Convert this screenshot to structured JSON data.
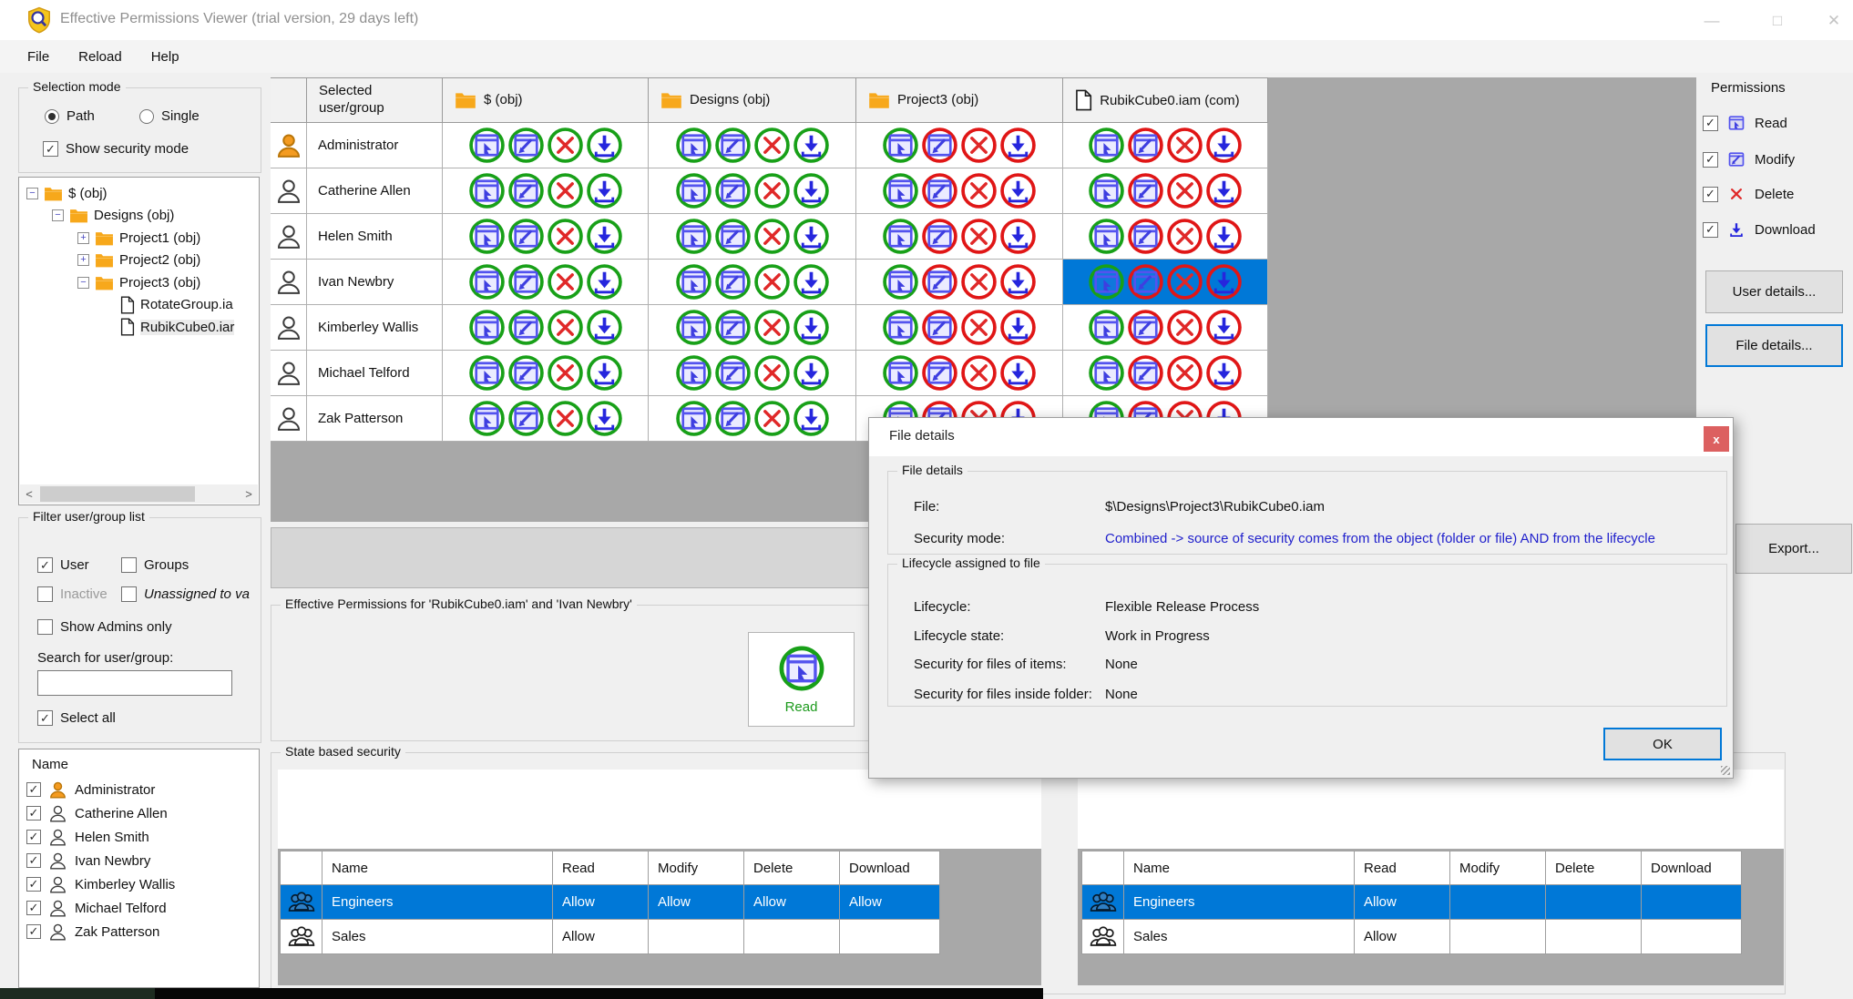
{
  "window": {
    "title": "Effective Permissions Viewer (trial version, 29 days left)",
    "controls": [
      "minimize",
      "maximize",
      "close"
    ]
  },
  "menu": {
    "items": [
      "File",
      "Reload",
      "Help"
    ]
  },
  "selection_mode": {
    "title": "Selection mode",
    "radios": [
      {
        "label": "Path",
        "checked": true
      },
      {
        "label": "Single",
        "checked": false
      }
    ],
    "show_security": {
      "label": "Show security mode",
      "checked": true
    }
  },
  "tree": {
    "items": [
      {
        "label": "$ (obj)",
        "icon": "folder",
        "expander": "minus",
        "indent": 0,
        "selected": false
      },
      {
        "label": "Designs (obj)",
        "icon": "folder",
        "expander": "minus",
        "indent": 1,
        "selected": false
      },
      {
        "label": "Project1 (obj)",
        "icon": "folder",
        "expander": "plus",
        "indent": 2,
        "selected": false
      },
      {
        "label": "Project2 (obj)",
        "icon": "folder",
        "expander": "plus",
        "indent": 2,
        "selected": false
      },
      {
        "label": "Project3 (obj)",
        "icon": "folder",
        "expander": "minus",
        "indent": 2,
        "selected": false
      },
      {
        "label": "RotateGroup.ia",
        "icon": "file",
        "expander": "none",
        "indent": 3,
        "selected": false
      },
      {
        "label": "RubikCube0.iar",
        "icon": "file",
        "expander": "none",
        "indent": 3,
        "selected": true
      }
    ]
  },
  "filter": {
    "title": "Filter user/group list",
    "user": {
      "label": "User",
      "checked": true
    },
    "groups": {
      "label": "Groups",
      "checked": false
    },
    "inactive": {
      "label": "Inactive",
      "checked": false
    },
    "unassigned": {
      "label": "Unassigned to va",
      "checked": false
    },
    "admins_only": {
      "label": "Show Admins only",
      "checked": false
    },
    "search_label": "Search for user/group:",
    "search_value": "",
    "select_all": {
      "label": "Select all",
      "checked": true
    }
  },
  "user_list": {
    "header": "Name",
    "users": [
      {
        "name": "Administrator",
        "checked": true,
        "admin": true
      },
      {
        "name": "Catherine Allen",
        "checked": true,
        "admin": false
      },
      {
        "name": "Helen Smith",
        "checked": true,
        "admin": false
      },
      {
        "name": "Ivan Newbry",
        "checked": true,
        "admin": false
      },
      {
        "name": "Kimberley Wallis",
        "checked": true,
        "admin": false
      },
      {
        "name": "Michael Telford",
        "checked": true,
        "admin": false
      },
      {
        "name": "Zak Patterson",
        "checked": true,
        "admin": false
      }
    ]
  },
  "grid": {
    "columns": [
      {
        "label": "Selected user/group",
        "icon": "none"
      },
      {
        "label": "$ (obj)",
        "icon": "folder"
      },
      {
        "label": "Designs (obj)",
        "icon": "folder"
      },
      {
        "label": "Project3 (obj)",
        "icon": "folder"
      },
      {
        "label": "RubikCube0.iam (com)",
        "icon": "file"
      }
    ],
    "permissions": [
      "read",
      "modify",
      "delete",
      "download"
    ],
    "rows": [
      {
        "name": "Administrator",
        "admin": true,
        "selected_col": -1,
        "cells": [
          [
            "allow",
            "allow",
            "allow",
            "allow"
          ],
          [
            "allow",
            "allow",
            "allow",
            "allow"
          ],
          [
            "allow",
            "deny",
            "deny",
            "deny"
          ],
          [
            "allow",
            "deny",
            "deny",
            "deny"
          ]
        ]
      },
      {
        "name": "Catherine Allen",
        "admin": false,
        "selected_col": -1,
        "cells": [
          [
            "allow",
            "allow",
            "allow",
            "allow"
          ],
          [
            "allow",
            "allow",
            "allow",
            "allow"
          ],
          [
            "allow",
            "deny",
            "deny",
            "deny"
          ],
          [
            "allow",
            "deny",
            "deny",
            "deny"
          ]
        ]
      },
      {
        "name": "Helen Smith",
        "admin": false,
        "selected_col": -1,
        "cells": [
          [
            "allow",
            "allow",
            "allow",
            "allow"
          ],
          [
            "allow",
            "allow",
            "allow",
            "allow"
          ],
          [
            "allow",
            "deny",
            "deny",
            "deny"
          ],
          [
            "allow",
            "deny",
            "deny",
            "deny"
          ]
        ]
      },
      {
        "name": "Ivan Newbry",
        "admin": false,
        "selected_col": 3,
        "cells": [
          [
            "allow",
            "allow",
            "allow",
            "allow"
          ],
          [
            "allow",
            "allow",
            "allow",
            "allow"
          ],
          [
            "allow",
            "deny",
            "deny",
            "deny"
          ],
          [
            "allow",
            "deny",
            "deny",
            "deny"
          ]
        ]
      },
      {
        "name": "Kimberley Wallis",
        "admin": false,
        "selected_col": -1,
        "cells": [
          [
            "allow",
            "allow",
            "allow",
            "allow"
          ],
          [
            "allow",
            "allow",
            "allow",
            "allow"
          ],
          [
            "allow",
            "deny",
            "deny",
            "deny"
          ],
          [
            "allow",
            "deny",
            "deny",
            "deny"
          ]
        ]
      },
      {
        "name": "Michael Telford",
        "admin": false,
        "selected_col": -1,
        "cells": [
          [
            "allow",
            "allow",
            "allow",
            "allow"
          ],
          [
            "allow",
            "allow",
            "allow",
            "allow"
          ],
          [
            "allow",
            "deny",
            "deny",
            "deny"
          ],
          [
            "allow",
            "deny",
            "deny",
            "deny"
          ]
        ]
      },
      {
        "name": "Zak Patterson",
        "admin": false,
        "selected_col": -1,
        "cells": [
          [
            "allow",
            "allow",
            "allow",
            "allow"
          ],
          [
            "allow",
            "allow",
            "allow",
            "allow"
          ],
          [
            "allow",
            "deny",
            "deny",
            "deny"
          ],
          [
            "allow",
            "deny",
            "deny",
            "deny"
          ]
        ]
      }
    ]
  },
  "right_panel": {
    "title": "Permissions",
    "items": [
      {
        "label": "Read",
        "icon": "read",
        "checked": true
      },
      {
        "label": "Modify",
        "icon": "modify",
        "checked": true
      },
      {
        "label": "Delete",
        "icon": "delete",
        "checked": true
      },
      {
        "label": "Download",
        "icon": "download",
        "checked": true
      }
    ],
    "user_details_label": "User details...",
    "file_details_label": "File details...",
    "export_label": "Export..."
  },
  "effective": {
    "title": "Effective Permissions  for  'RubikCube0.iam' and 'Ivan Newbry'",
    "badge_label": "Read"
  },
  "state_security": {
    "title": "State based security",
    "left_table": {
      "headers": [
        "Name",
        "Read",
        "Modify",
        "Delete",
        "Download"
      ],
      "rows": [
        {
          "name": "Engineers",
          "selected": true,
          "values": [
            "Allow",
            "Allow",
            "Allow",
            "Allow"
          ]
        },
        {
          "name": "Sales",
          "selected": false,
          "values": [
            "Allow",
            "",
            "",
            ""
          ]
        }
      ]
    },
    "right_table": {
      "headers": [
        "Name",
        "Read",
        "Modify",
        "Delete",
        "Download"
      ],
      "rows": [
        {
          "name": "Engineers",
          "selected": true,
          "values": [
            "Allow",
            "",
            "",
            ""
          ]
        },
        {
          "name": "Sales",
          "selected": false,
          "values": [
            "Allow",
            "",
            "",
            ""
          ]
        }
      ]
    }
  },
  "dialog": {
    "title": "File details",
    "close_icon": "x",
    "groups": [
      {
        "title": "File details",
        "rows": [
          {
            "label": "File:",
            "value": "$\\Designs\\Project3\\RubikCube0.iam",
            "style": "plain"
          },
          {
            "label": "Security mode:",
            "value": "Combined -> source of security comes from the object (folder or file) AND from the lifecycle",
            "style": "link"
          }
        ]
      },
      {
        "title": "Lifecycle assigned to file",
        "rows": [
          {
            "label": "Lifecycle:",
            "value": "Flexible Release Process",
            "style": "plain"
          },
          {
            "label": "Lifecycle state:",
            "value": "Work in Progress",
            "style": "plain"
          },
          {
            "label": "Security for files of items:",
            "value": "None",
            "style": "plain"
          },
          {
            "label": "Security for files inside folder:",
            "value": "None",
            "style": "plain"
          }
        ]
      }
    ],
    "ok_label": "OK"
  },
  "colors": {
    "allow_ring": "#18a018",
    "deny_ring": "#e01616",
    "selection_blue": "#0078d7",
    "glyph_blue": "#5353ee",
    "delete_red": "#e02828",
    "folder": "#f7a81b",
    "admin_orange": "#f49b20",
    "link_blue": "#2121cc",
    "close_red": "#dc6060"
  }
}
